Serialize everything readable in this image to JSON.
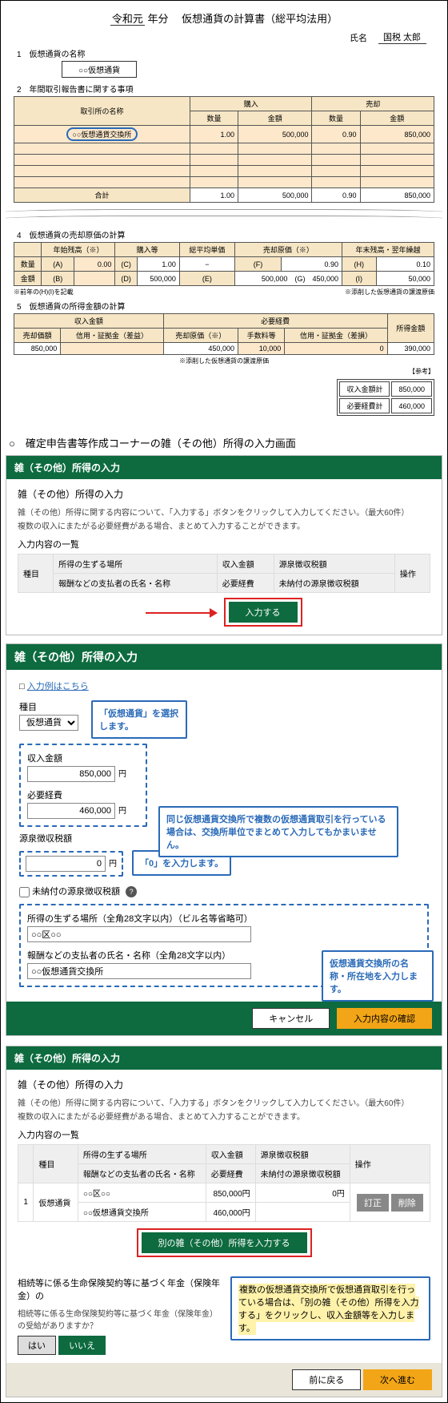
{
  "worksheet": {
    "title_pre": "令和元",
    "title_mid": "年分",
    "title_main": "仮想通貨の計算書（総平均法用）",
    "name_label": "氏名",
    "name_value": "国税 太郎",
    "sec1": "1　仮想通貨の名称",
    "crypto_name": "○○仮想通貨",
    "sec2": "2　年間取引報告書に関する事項",
    "tbl2_h_exchange": "取引所の名称",
    "tbl2_h_buy": "購入",
    "tbl2_h_sell": "売却",
    "tbl2_h_qty": "数量",
    "tbl2_h_amt": "金額",
    "exchange_ringed": "○○仮想通貨交換所",
    "buy_qty": "1.00",
    "buy_amt": "500,000",
    "sell_qty": "0.90",
    "sell_amt": "850,000",
    "total_label": "合計",
    "sec4": "4　仮想通貨の売却原価の計算",
    "t4_h1": "年始残高（※）",
    "t4_h2": "購入等",
    "t4_h3": "総平均単価",
    "t4_h4": "売却原価（※）",
    "t4_h5": "年末残高・翌年繰越",
    "t4_r1lbl": "数量",
    "t4_A": "(A)",
    "t4_A_val": "0.00",
    "t4_C": "(C)",
    "t4_C_val": "1.00",
    "t4_E_val": "−",
    "t4_F": "(F)",
    "t4_F_val": "0.90",
    "t4_H": "(H)",
    "t4_H_val": "0.10",
    "t4_r2lbl": "金額",
    "t4_B": "(B)",
    "t4_D": "(D)",
    "t4_D_val": "500,000",
    "t4_E": "(E)",
    "t4_E_val2": "500,000",
    "t4_G": "(G)",
    "t4_G_val": "450,000",
    "t4_I": "(I)",
    "t4_I_val": "50,000",
    "t4_note_left": "※前年の(H)(I)を記載",
    "t4_note_right": "※添削した仮想通貨の譲渡原価",
    "sec5": "5　仮想通貨の所得金額の計算",
    "t5_h_rev": "収入金額",
    "t5_h_exp": "必要経費",
    "t5_h_inc": "所得金額",
    "t5_c1": "売却価額",
    "t5_c2": "信用・証拠金（差益）",
    "t5_c3": "売却原価（※）",
    "t5_c4": "手数料等",
    "t5_c5": "信用・証拠金（差損）",
    "t5_v1": "850,000",
    "t5_v3": "450,000",
    "t5_v4": "10,000",
    "t5_v5": "0",
    "t5_v6": "390,000",
    "t5_note": "※添削した仮想通貨の譲渡原価",
    "t5_sankaku": "【参考】",
    "sum_rev_lbl": "収入金額計",
    "sum_rev_val": "850,000",
    "sum_exp_lbl": "必要経費計",
    "sum_exp_val": "460,000"
  },
  "screen_lead": "○　確定申告書等作成コーナーの雑（その他）所得の入力画面",
  "p1": {
    "hd": "雑（その他）所得の入力",
    "subhd": "雑（その他）所得の入力",
    "desc1": "雑（その他）所得に関する内容について、「入力する」ボタンをクリックして入力してください。（最大60件）",
    "desc2": "複数の収入にまたがる必要経費がある場合、まとめて入力することができます。",
    "listhd": "入力内容の一覧",
    "col_kind": "種目",
    "col_place": "所得の生ずる場所",
    "col_rev": "収入金額",
    "col_tax": "源泉徴収税額",
    "col_op": "操作",
    "col_payer": "報酬などの支払者の氏名・名称",
    "col_exp": "必要経費",
    "col_unpaid": "未納付の源泉徴収税額",
    "btn_input": "入力する"
  },
  "entry": {
    "hd": "雑（その他）所得の入力",
    "example_link": "入力例はこちら",
    "kind_label": "種目",
    "kind_value": "仮想通貨",
    "callout_kind": "「仮想通貨」を選択します。",
    "rev_label": "収入金額",
    "rev_value": "850,000",
    "unit_yen": "円",
    "exp_label": "必要経費",
    "exp_value": "460,000",
    "callout_exp": "同じ仮想通貨交換所で複数の仮想通貨取引を行っている場合は、交換所単位でまとめて入力してもかまいません。",
    "tax_label": "源泉徴収税額",
    "tax_value": "0",
    "callout_tax": "「0」を入力します。",
    "unpaid_label": "未納付の源泉徴収税額",
    "place_label": "所得の生ずる場所（全角28文字以内）（ビル名等省略可）",
    "place_value": "○○区○○",
    "payer_label": "報酬などの支払者の氏名・名称（全角28文字以内）",
    "payer_value": "○○仮想通貨交換所",
    "callout_place": "仮想通貨交換所の名称・所在地を入力します。",
    "btn_cancel": "キャンセル",
    "btn_confirm": "入力内容の確認"
  },
  "p3": {
    "hd": "雑（その他）所得の入力",
    "subhd": "雑（その他）所得の入力",
    "desc1": "雑（その他）所得に関する内容について、「入力する」ボタンをクリックして入力してください。（最大60件）",
    "desc2": "複数の収入にまたがる必要経費がある場合、まとめて入力することができます。",
    "listhd": "入力内容の一覧",
    "row_no": "1",
    "row_kind": "仮想通貨",
    "row_place": "○○区○○",
    "row_rev": "850,000円",
    "row_tax": "0円",
    "row_payer": "○○仮想通貨交換所",
    "row_exp": "460,000円",
    "btn_edit": "訂正",
    "btn_del": "削除",
    "btn_another": "別の雑（その他）所得を入力する",
    "callout_multi": "複数の仮想通貨交換所で仮想通貨取引を行っている場合は、「別の雑（その他）所得を入力する」をクリックし、収入金額等を入力します。",
    "ins_hd": "相続等に係る生命保険契約等に基づく年金（保険年金）の",
    "ins_desc": "相続等に係る生命保険契約等に基づく年金（保険年金）の受給がありますか？",
    "btn_yes": "はい",
    "btn_no": "いいえ",
    "btn_back": "前に戻る",
    "btn_next": "次へ進む"
  },
  "icons": {
    "help": "?"
  },
  "table_cols": {
    "kind": "種目",
    "place": "所得の生ずる場所",
    "rev": "収入金額",
    "tax": "源泉徴収税額",
    "op": "操作",
    "payer": "報酬などの支払者の氏名・名称",
    "exp": "必要経費",
    "unpaid": "未納付の源泉徴収税額"
  }
}
